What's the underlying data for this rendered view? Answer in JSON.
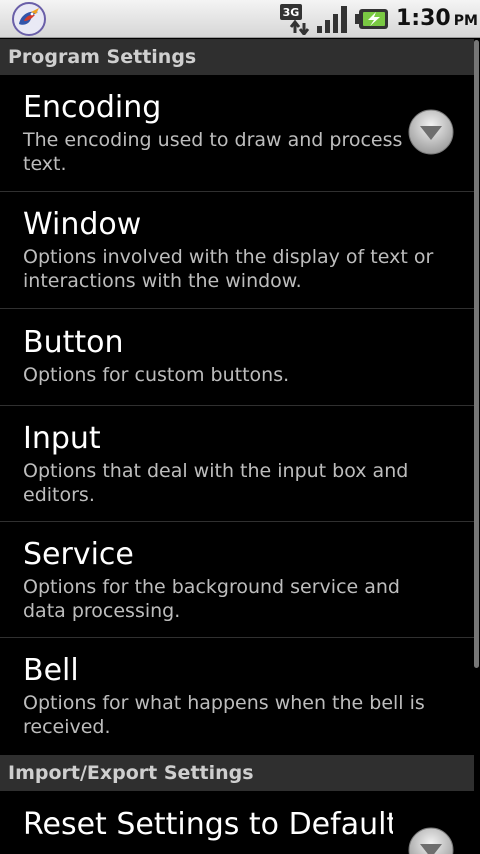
{
  "status_bar": {
    "network_type": "3G",
    "time": "1:30",
    "ampm": "PM",
    "app_icon": "app-bird-icon",
    "network_icon": "network-3g-icon",
    "signal_icon": "signal-bars-icon",
    "battery_icon": "battery-charging-icon"
  },
  "sections": {
    "program": {
      "title": "Program Settings"
    },
    "import_export": {
      "title": "Import/Export Settings"
    }
  },
  "items": {
    "encoding": {
      "title": "Encoding",
      "summary": "The encoding used to draw and process text."
    },
    "window": {
      "title": "Window",
      "summary": "Options involved with the display of text or interactions with the window."
    },
    "button": {
      "title": "Button",
      "summary": "Options for custom buttons."
    },
    "input": {
      "title": "Input",
      "summary": "Options that deal with the input box and editors."
    },
    "service": {
      "title": "Service",
      "summary": "Options for the background service and data processing."
    },
    "bell": {
      "title": "Bell",
      "summary": "Options for what happens when the bell is received."
    },
    "reset": {
      "title": "Reset Settings to Defaults"
    }
  },
  "colors": {
    "background": "#000000",
    "section_header_bg": "#2f2f2f",
    "summary_text": "#bdbdbd",
    "status_bar_bg": "#e6e6e6"
  }
}
